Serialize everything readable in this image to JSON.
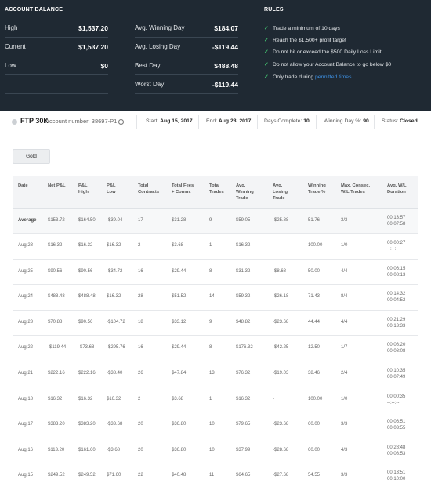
{
  "account_balance": {
    "title": "ACCOUNT BALANCE",
    "left": [
      {
        "label": "High",
        "value": "$1,537.20"
      },
      {
        "label": "Current",
        "value": "$1,537.20"
      },
      {
        "label": "Low",
        "value": "$0"
      }
    ],
    "right": [
      {
        "label": "Avg. Winning Day",
        "value": "$184.07"
      },
      {
        "label": "Avg. Losing Day",
        "value": "-$119.44"
      },
      {
        "label": "Best Day",
        "value": "$488.48"
      },
      {
        "label": "Worst Day",
        "value": "-$119.44"
      }
    ]
  },
  "rules": {
    "title": "RULES",
    "items": [
      "Trade a minimum of 10 days",
      "Reach the $1,500+ profit target",
      "Do not hit or exceed the $500 Daily Loss Limit",
      "Do not allow your Account Balance to go below $0"
    ],
    "last_prefix": "Only trade during ",
    "last_link": "permitted times"
  },
  "info": {
    "plan": "FTP 30K",
    "account": "Account number: 38697-P1",
    "start_label": "Start:",
    "start": "Aug 15, 2017",
    "end_label": "End:",
    "end": "Aug 28, 2017",
    "days_label": "Days Complete:",
    "days": "10",
    "winning_label": "Winning Day %:",
    "winning": "90",
    "status_label": "Status:",
    "status": "Closed"
  },
  "gold_button": "Gold",
  "table": {
    "headers": [
      "Date",
      "Net P&L",
      "P&L\nHigh",
      "P&L\nLow",
      "Total\nContracts",
      "Total Fees\n+ Comm.",
      "Total\nTrades",
      "Avg.\nWinning\nTrade",
      "Avg.\nLosing\nTrade",
      "Winning\nTrade %",
      "Max. Consec.\nW/L Trades",
      "Avg. W/L\nDuration"
    ],
    "rows": [
      {
        "date": "Average",
        "net": "$153.72",
        "high": "$164.50",
        "low": "-$39.04",
        "contracts": "17",
        "fees": "$31.28",
        "trades": "9",
        "avg_win": "$59.05",
        "avg_loss": "-$25.88",
        "win_pct": "51.76",
        "consec": "3/3",
        "dur1": "00:13:57",
        "dur2": "00:07:58"
      },
      {
        "date": "Aug 28",
        "net": "$16.32",
        "high": "$16.32",
        "low": "$16.32",
        "contracts": "2",
        "fees": "$3.68",
        "trades": "1",
        "avg_win": "$16.32",
        "avg_loss": "-",
        "win_pct": "100.00",
        "consec": "1/0",
        "dur1": "00:00:27",
        "dur2": "--:--:--"
      },
      {
        "date": "Aug 25",
        "net": "$90.56",
        "high": "$90.56",
        "low": "-$34.72",
        "contracts": "16",
        "fees": "$29.44",
        "trades": "8",
        "avg_win": "$31.32",
        "avg_loss": "-$8.68",
        "win_pct": "50.00",
        "consec": "4/4",
        "dur1": "00:06:15",
        "dur2": "00:08:13"
      },
      {
        "date": "Aug 24",
        "net": "$488.48",
        "high": "$488.48",
        "low": "$16.32",
        "contracts": "28",
        "fees": "$51.52",
        "trades": "14",
        "avg_win": "$59.32",
        "avg_loss": "-$26.18",
        "win_pct": "71.43",
        "consec": "8/4",
        "dur1": "00:14:32",
        "dur2": "00:04:52"
      },
      {
        "date": "Aug 23",
        "net": "$70.88",
        "high": "$90.56",
        "low": "-$104.72",
        "contracts": "18",
        "fees": "$33.12",
        "trades": "9",
        "avg_win": "$48.82",
        "avg_loss": "-$23.68",
        "win_pct": "44.44",
        "consec": "4/4",
        "dur1": "00:21:29",
        "dur2": "00:13:33"
      },
      {
        "date": "Aug 22",
        "net": "-$119.44",
        "high": "-$73.68",
        "low": "-$295.76",
        "contracts": "16",
        "fees": "$29.44",
        "trades": "8",
        "avg_win": "$176.32",
        "avg_loss": "-$42.25",
        "win_pct": "12.50",
        "consec": "1/7",
        "dur1": "00:08:20",
        "dur2": "00:08:08"
      },
      {
        "date": "Aug 21",
        "net": "$222.16",
        "high": "$222.16",
        "low": "-$38.40",
        "contracts": "26",
        "fees": "$47.84",
        "trades": "13",
        "avg_win": "$76.32",
        "avg_loss": "-$19.03",
        "win_pct": "38.46",
        "consec": "2/4",
        "dur1": "00:10:35",
        "dur2": "00:07:49"
      },
      {
        "date": "Aug 18",
        "net": "$16.32",
        "high": "$16.32",
        "low": "$16.32",
        "contracts": "2",
        "fees": "$3.68",
        "trades": "1",
        "avg_win": "$16.32",
        "avg_loss": "-",
        "win_pct": "100.00",
        "consec": "1/0",
        "dur1": "00:00:35",
        "dur2": "--:--:--"
      },
      {
        "date": "Aug 17",
        "net": "$383.20",
        "high": "$383.20",
        "low": "-$33.68",
        "contracts": "20",
        "fees": "$36.80",
        "trades": "10",
        "avg_win": "$79.65",
        "avg_loss": "-$23.68",
        "win_pct": "60.00",
        "consec": "3/3",
        "dur1": "00:06:51",
        "dur2": "00:03:55"
      },
      {
        "date": "Aug 16",
        "net": "$113.20",
        "high": "$161.60",
        "low": "-$3.68",
        "contracts": "20",
        "fees": "$36.80",
        "trades": "10",
        "avg_win": "$37.99",
        "avg_loss": "-$28.68",
        "win_pct": "60.00",
        "consec": "4/3",
        "dur1": "00:28:48",
        "dur2": "00:08:53"
      },
      {
        "date": "Aug 15",
        "net": "$249.52",
        "high": "$249.52",
        "low": "$71.60",
        "contracts": "22",
        "fees": "$40.48",
        "trades": "11",
        "avg_win": "$64.65",
        "avg_loss": "-$27.68",
        "win_pct": "54.55",
        "consec": "3/3",
        "dur1": "00:13:51",
        "dur2": "00:10:00"
      }
    ]
  }
}
